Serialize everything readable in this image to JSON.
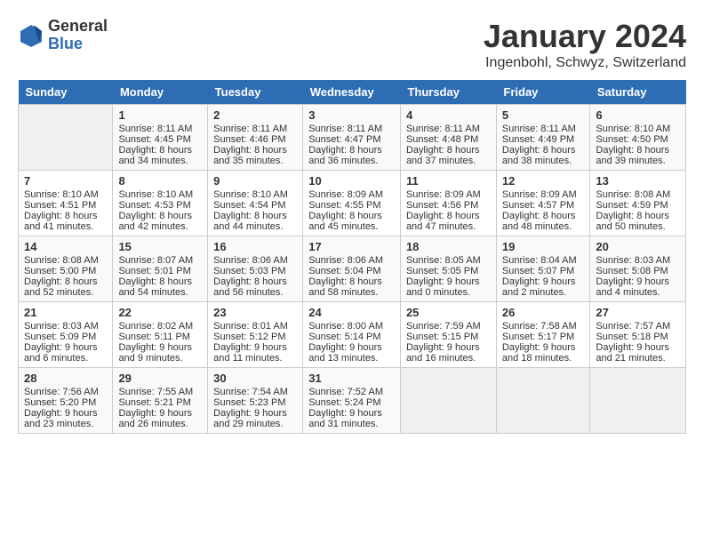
{
  "logo": {
    "general": "General",
    "blue": "Blue"
  },
  "title": "January 2024",
  "location": "Ingenbohl, Schwyz, Switzerland",
  "days": [
    "Sunday",
    "Monday",
    "Tuesday",
    "Wednesday",
    "Thursday",
    "Friday",
    "Saturday"
  ],
  "weeks": [
    [
      {
        "date": "",
        "text": ""
      },
      {
        "date": "1",
        "text": "Sunrise: 8:11 AM\nSunset: 4:45 PM\nDaylight: 8 hours\nand 34 minutes."
      },
      {
        "date": "2",
        "text": "Sunrise: 8:11 AM\nSunset: 4:46 PM\nDaylight: 8 hours\nand 35 minutes."
      },
      {
        "date": "3",
        "text": "Sunrise: 8:11 AM\nSunset: 4:47 PM\nDaylight: 8 hours\nand 36 minutes."
      },
      {
        "date": "4",
        "text": "Sunrise: 8:11 AM\nSunset: 4:48 PM\nDaylight: 8 hours\nand 37 minutes."
      },
      {
        "date": "5",
        "text": "Sunrise: 8:11 AM\nSunset: 4:49 PM\nDaylight: 8 hours\nand 38 minutes."
      },
      {
        "date": "6",
        "text": "Sunrise: 8:10 AM\nSunset: 4:50 PM\nDaylight: 8 hours\nand 39 minutes."
      }
    ],
    [
      {
        "date": "7",
        "text": "Sunrise: 8:10 AM\nSunset: 4:51 PM\nDaylight: 8 hours\nand 41 minutes."
      },
      {
        "date": "8",
        "text": "Sunrise: 8:10 AM\nSunset: 4:53 PM\nDaylight: 8 hours\nand 42 minutes."
      },
      {
        "date": "9",
        "text": "Sunrise: 8:10 AM\nSunset: 4:54 PM\nDaylight: 8 hours\nand 44 minutes."
      },
      {
        "date": "10",
        "text": "Sunrise: 8:09 AM\nSunset: 4:55 PM\nDaylight: 8 hours\nand 45 minutes."
      },
      {
        "date": "11",
        "text": "Sunrise: 8:09 AM\nSunset: 4:56 PM\nDaylight: 8 hours\nand 47 minutes."
      },
      {
        "date": "12",
        "text": "Sunrise: 8:09 AM\nSunset: 4:57 PM\nDaylight: 8 hours\nand 48 minutes."
      },
      {
        "date": "13",
        "text": "Sunrise: 8:08 AM\nSunset: 4:59 PM\nDaylight: 8 hours\nand 50 minutes."
      }
    ],
    [
      {
        "date": "14",
        "text": "Sunrise: 8:08 AM\nSunset: 5:00 PM\nDaylight: 8 hours\nand 52 minutes."
      },
      {
        "date": "15",
        "text": "Sunrise: 8:07 AM\nSunset: 5:01 PM\nDaylight: 8 hours\nand 54 minutes."
      },
      {
        "date": "16",
        "text": "Sunrise: 8:06 AM\nSunset: 5:03 PM\nDaylight: 8 hours\nand 56 minutes."
      },
      {
        "date": "17",
        "text": "Sunrise: 8:06 AM\nSunset: 5:04 PM\nDaylight: 8 hours\nand 58 minutes."
      },
      {
        "date": "18",
        "text": "Sunrise: 8:05 AM\nSunset: 5:05 PM\nDaylight: 9 hours\nand 0 minutes."
      },
      {
        "date": "19",
        "text": "Sunrise: 8:04 AM\nSunset: 5:07 PM\nDaylight: 9 hours\nand 2 minutes."
      },
      {
        "date": "20",
        "text": "Sunrise: 8:03 AM\nSunset: 5:08 PM\nDaylight: 9 hours\nand 4 minutes."
      }
    ],
    [
      {
        "date": "21",
        "text": "Sunrise: 8:03 AM\nSunset: 5:09 PM\nDaylight: 9 hours\nand 6 minutes."
      },
      {
        "date": "22",
        "text": "Sunrise: 8:02 AM\nSunset: 5:11 PM\nDaylight: 9 hours\nand 9 minutes."
      },
      {
        "date": "23",
        "text": "Sunrise: 8:01 AM\nSunset: 5:12 PM\nDaylight: 9 hours\nand 11 minutes."
      },
      {
        "date": "24",
        "text": "Sunrise: 8:00 AM\nSunset: 5:14 PM\nDaylight: 9 hours\nand 13 minutes."
      },
      {
        "date": "25",
        "text": "Sunrise: 7:59 AM\nSunset: 5:15 PM\nDaylight: 9 hours\nand 16 minutes."
      },
      {
        "date": "26",
        "text": "Sunrise: 7:58 AM\nSunset: 5:17 PM\nDaylight: 9 hours\nand 18 minutes."
      },
      {
        "date": "27",
        "text": "Sunrise: 7:57 AM\nSunset: 5:18 PM\nDaylight: 9 hours\nand 21 minutes."
      }
    ],
    [
      {
        "date": "28",
        "text": "Sunrise: 7:56 AM\nSunset: 5:20 PM\nDaylight: 9 hours\nand 23 minutes."
      },
      {
        "date": "29",
        "text": "Sunrise: 7:55 AM\nSunset: 5:21 PM\nDaylight: 9 hours\nand 26 minutes."
      },
      {
        "date": "30",
        "text": "Sunrise: 7:54 AM\nSunset: 5:23 PM\nDaylight: 9 hours\nand 29 minutes."
      },
      {
        "date": "31",
        "text": "Sunrise: 7:52 AM\nSunset: 5:24 PM\nDaylight: 9 hours\nand 31 minutes."
      },
      {
        "date": "",
        "text": ""
      },
      {
        "date": "",
        "text": ""
      },
      {
        "date": "",
        "text": ""
      }
    ]
  ]
}
